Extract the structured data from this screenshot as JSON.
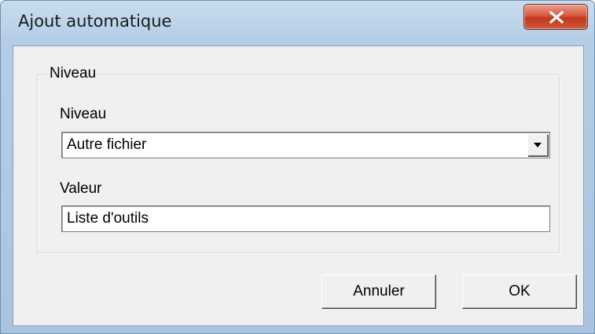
{
  "window": {
    "title": "Ajout automatique",
    "close_icon": "close-x-icon"
  },
  "group": {
    "legend": "Niveau"
  },
  "niveau": {
    "label": "Niveau",
    "selected": "Autre fichier",
    "dropdown_icon": "chevron-down-icon"
  },
  "valeur": {
    "label": "Valeur",
    "value": "Liste d'outils"
  },
  "buttons": {
    "cancel": "Annuler",
    "ok": "OK"
  },
  "colors": {
    "frame": "#b5cde6",
    "client": "#f0f0f0",
    "close_button": "#c2371f"
  }
}
